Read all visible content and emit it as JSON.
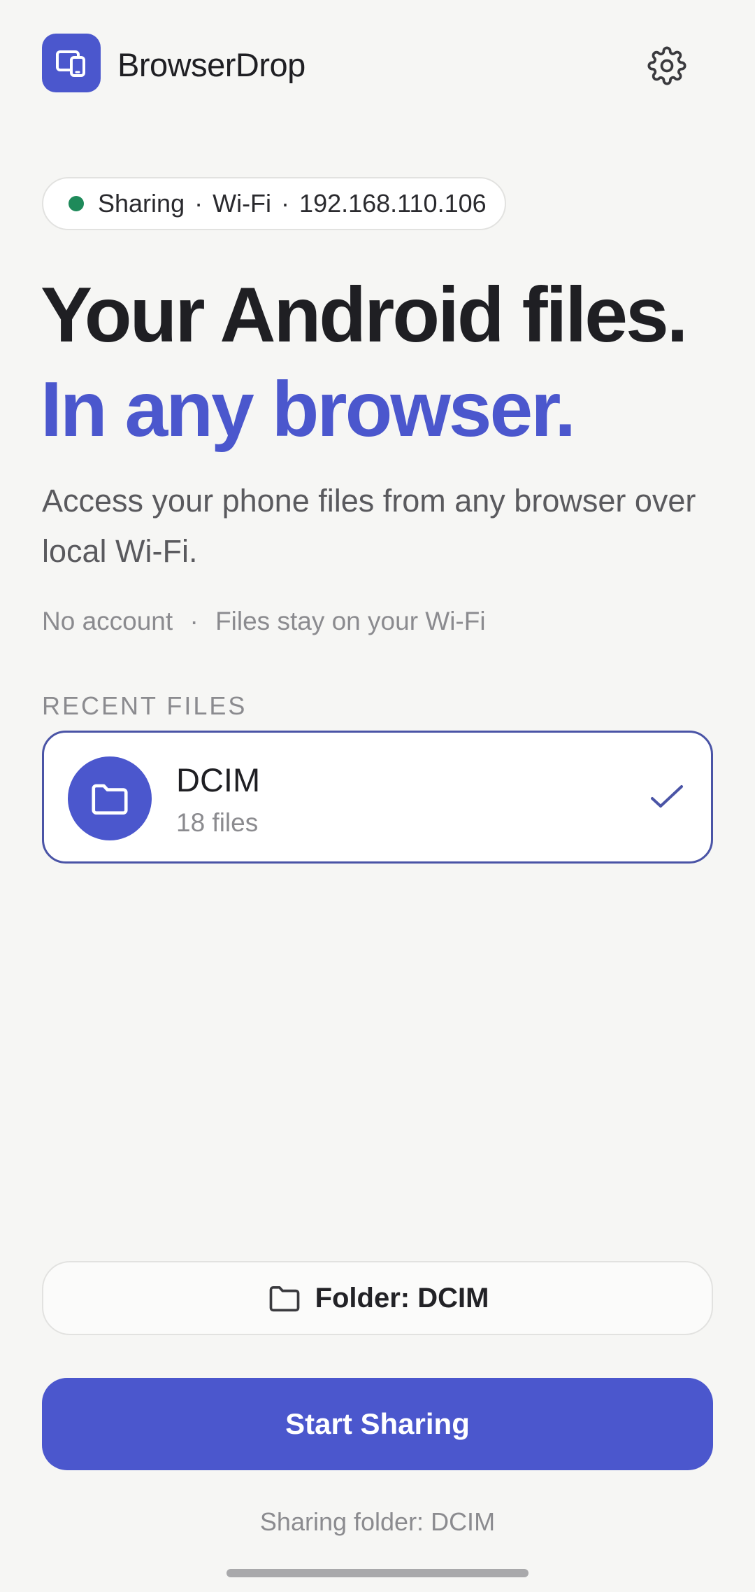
{
  "header": {
    "app_name": "BrowserDrop",
    "logo_icon": "devices-icon",
    "settings_icon": "gear-icon"
  },
  "status": {
    "state": "Sharing",
    "network": "Wi-Fi",
    "ip": "192.168.110.106",
    "separator": "·",
    "dot_color": "#1e8a5a"
  },
  "hero": {
    "line1": "Your Android files.",
    "line2": "In any browser.",
    "subtitle": "Access your phone files from any browser over local Wi-Fi.",
    "meta_1": "No account",
    "meta_sep": "·",
    "meta_2": "Files stay on your Wi-Fi"
  },
  "recent": {
    "label": "RECENT FILES",
    "items": [
      {
        "name": "DCIM",
        "count": "18 files",
        "icon": "folder-icon",
        "selected": true
      }
    ]
  },
  "footer": {
    "folder_button_label": "Folder: DCIM",
    "start_button_label": "Start Sharing",
    "caption": "Sharing folder: DCIM"
  },
  "colors": {
    "accent": "#4b57cd",
    "background": "#f6f6f4",
    "card_border": "#4a54a6"
  }
}
